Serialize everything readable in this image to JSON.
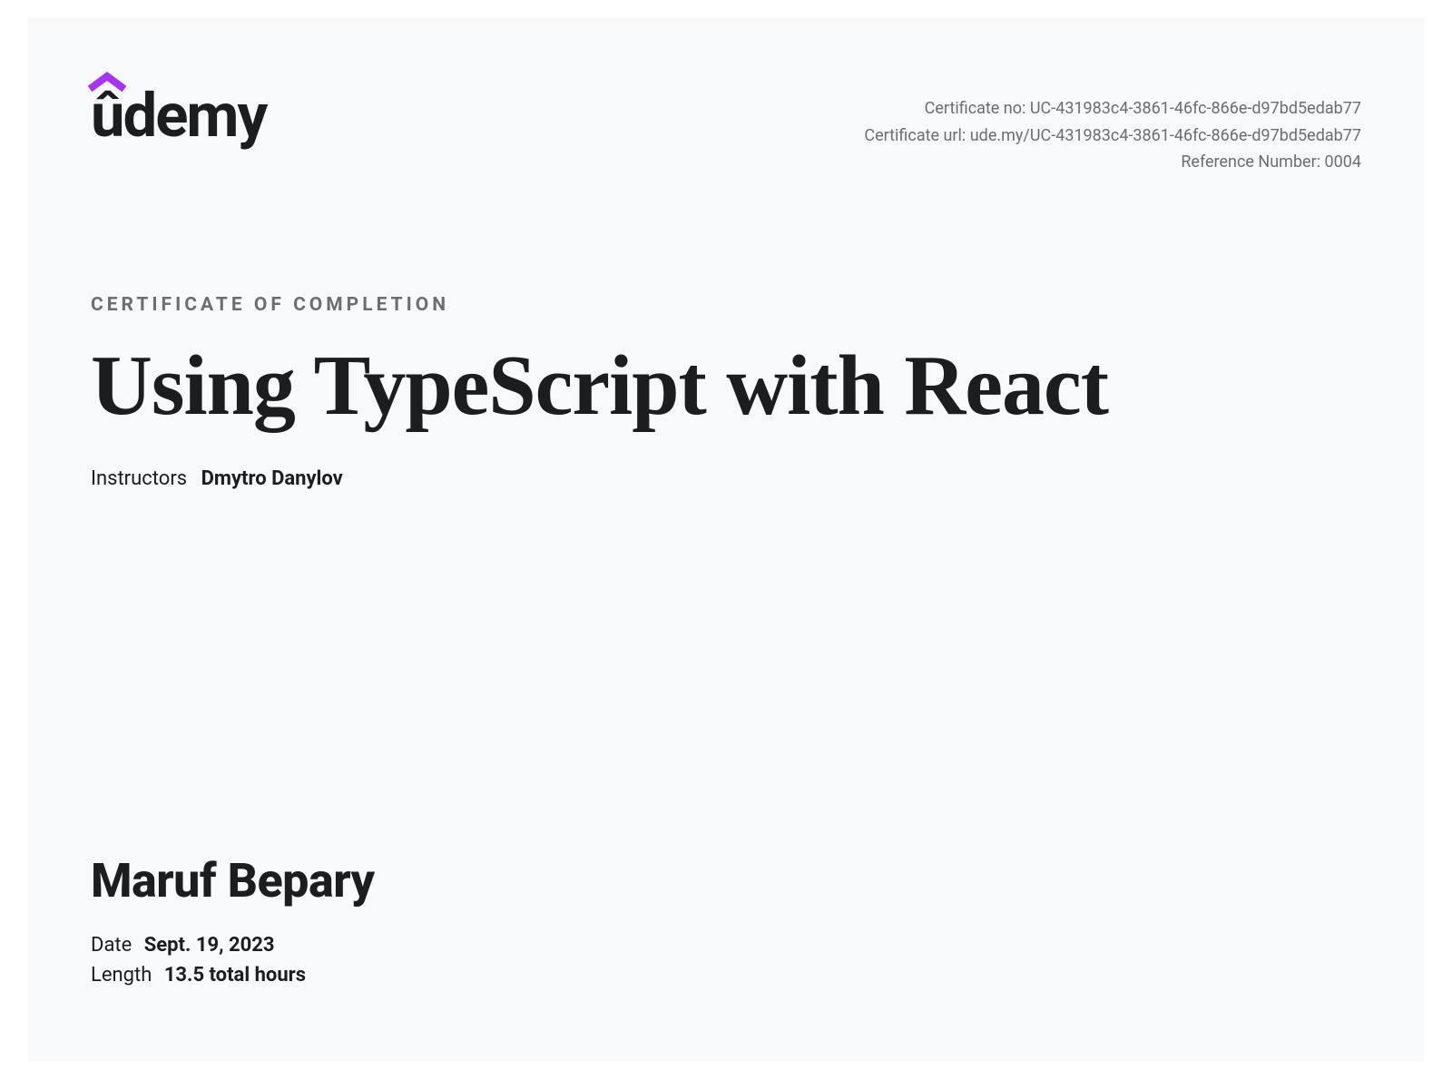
{
  "logo": {
    "text": "ûdemy",
    "accent_color": "#a435f0"
  },
  "meta": {
    "certificate_no_label": "Certificate no:",
    "certificate_no_value": "UC-431983c4-3861-46fc-866e-d97bd5edab77",
    "certificate_url_label": "Certificate url:",
    "certificate_url_value": "ude.my/UC-431983c4-3861-46fc-866e-d97bd5edab77",
    "reference_label": "Reference Number:",
    "reference_value": "0004"
  },
  "completion_label": "CERTIFICATE OF COMPLETION",
  "course_title": "Using TypeScript with React",
  "instructors": {
    "label": "Instructors",
    "name": "Dmytro Danylov"
  },
  "student_name": "Maruf Bepary",
  "date": {
    "label": "Date",
    "value": "Sept. 19, 2023"
  },
  "length": {
    "label": "Length",
    "value": "13.5 total hours"
  }
}
